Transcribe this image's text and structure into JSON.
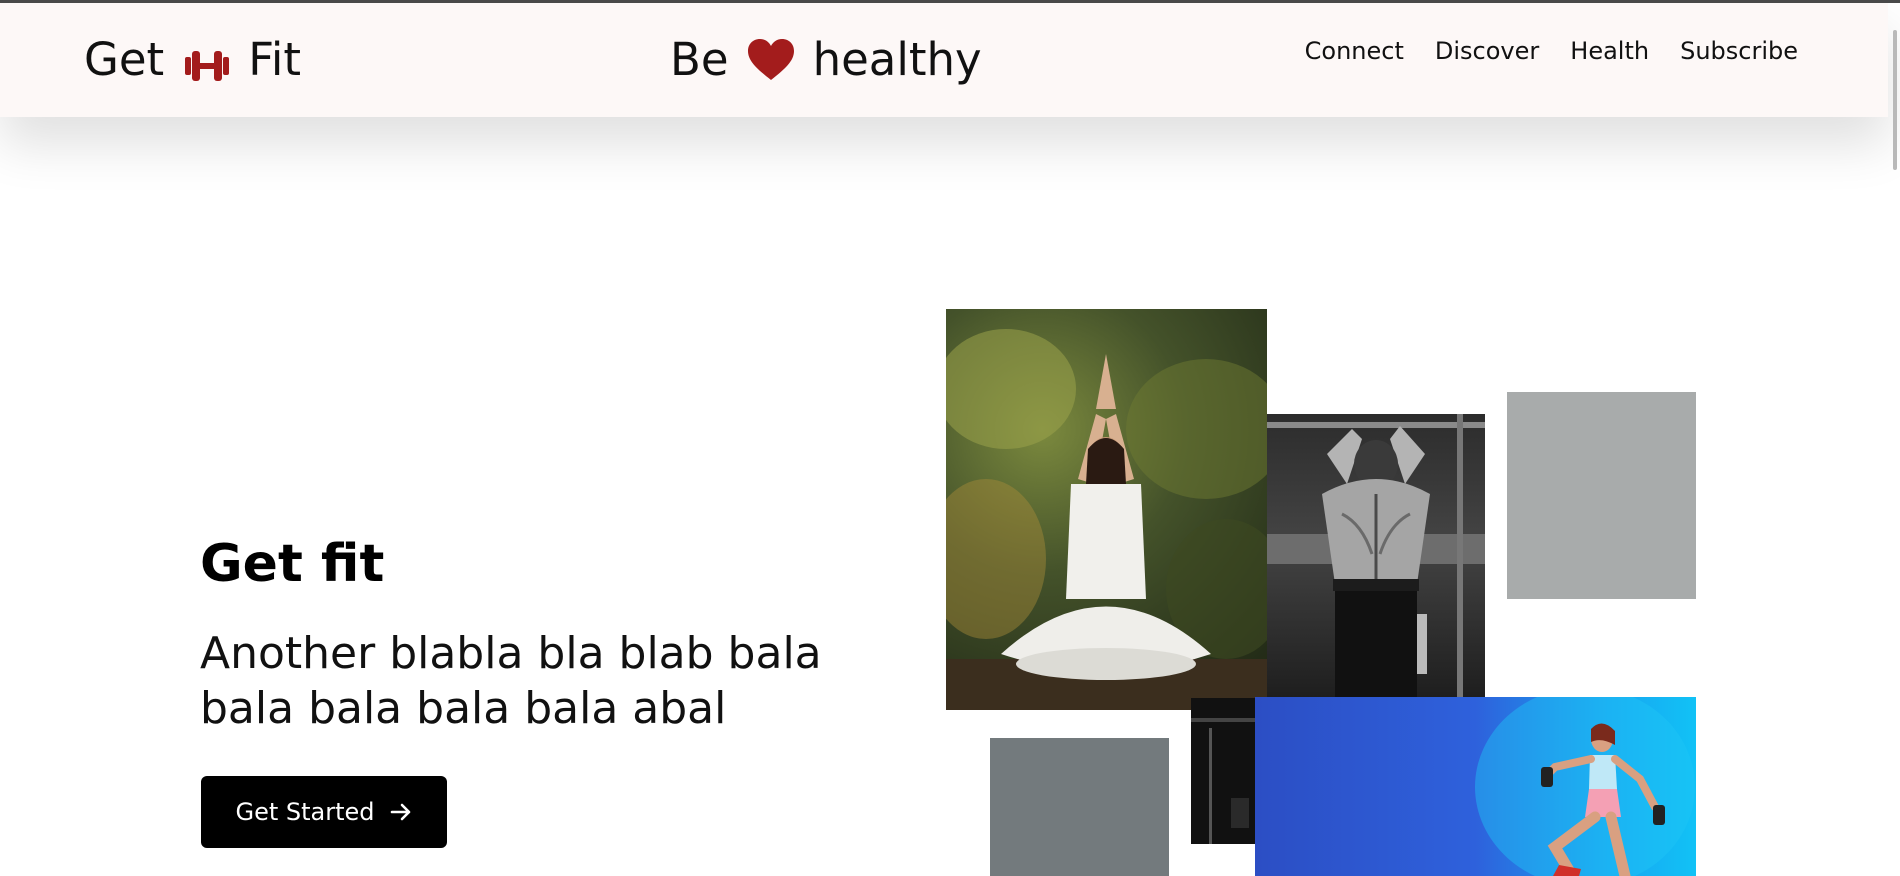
{
  "brand": {
    "word_before": "Get",
    "word_after": "Fit",
    "icon": "dumbbell-icon",
    "icon_color": "#a31c1c"
  },
  "tagline": {
    "word_before": "Be",
    "word_after": "healthy",
    "icon": "heart-icon",
    "icon_color": "#a31c1c"
  },
  "nav": {
    "links": [
      "Connect",
      "Discover",
      "Health",
      "Subscribe"
    ]
  },
  "hero": {
    "title": "Get fit",
    "subtitle": "Another blabla bla blab bala bala bala bala bala abal",
    "cta_label": "Get Started",
    "cta_icon": "arrow-right-icon"
  },
  "colors": {
    "navbar_bg": "#fdf8f7",
    "cta_bg": "#000000",
    "accent": "#a31c1c"
  }
}
